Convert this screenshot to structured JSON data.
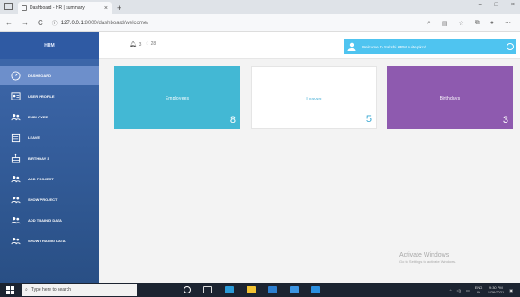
{
  "browser": {
    "tab_title": "Dashboard - HR | summary",
    "tab_close": "×",
    "new_tab": "+",
    "url_scheme_host": "127.0.0.1",
    "url_path": ":8000/dashboard/welcome/",
    "back": "←",
    "forward": "→",
    "reload": "C",
    "minimize": "–",
    "maximize": "□",
    "close": "×"
  },
  "sidebar": {
    "brand": "HRM",
    "items": [
      {
        "label": "DASHBOARD",
        "icon": "dashboard-icon",
        "active": true
      },
      {
        "label": "USER PROFILE",
        "icon": "user-profile-icon"
      },
      {
        "label": "EMPLOYEE",
        "icon": "employee-icon"
      },
      {
        "label": "LEAVE",
        "icon": "leave-icon"
      },
      {
        "label": "BIRTHDAY 3",
        "icon": "birthday-icon"
      },
      {
        "label": "ADD PROJECT",
        "icon": "add-project-icon"
      },
      {
        "label": "SHOW PROJECT",
        "icon": "show-project-icon"
      },
      {
        "label": "ADD TRAINIG DATA",
        "icon": "add-training-icon"
      },
      {
        "label": "SHOW TRAINIG DATA",
        "icon": "show-training-icon"
      }
    ]
  },
  "header": {
    "bell_count": "3",
    "chat_count": "28",
    "welcome": "Welcome to Sakshi HRM suite,pkcd"
  },
  "cards": [
    {
      "label": "Employees",
      "value": "8"
    },
    {
      "label": "Leaves",
      "value": "5"
    },
    {
      "label": "Birthdays",
      "value": "3"
    }
  ],
  "watermark": {
    "title": "Activate Windows",
    "subtitle": "Go to Settings to activate Windows."
  },
  "taskbar": {
    "search_placeholder": "Type here to search",
    "lang": "ENG",
    "region": "IN",
    "time": "9:30 PM",
    "date": "5/26/2021"
  },
  "colors": {
    "sidebar": "#3a63a6",
    "card_employees": "#43b8d4",
    "card_leaves": "#ffffff",
    "card_birthdays": "#8e5aaf",
    "welcome_bar": "#4fc4f0"
  }
}
